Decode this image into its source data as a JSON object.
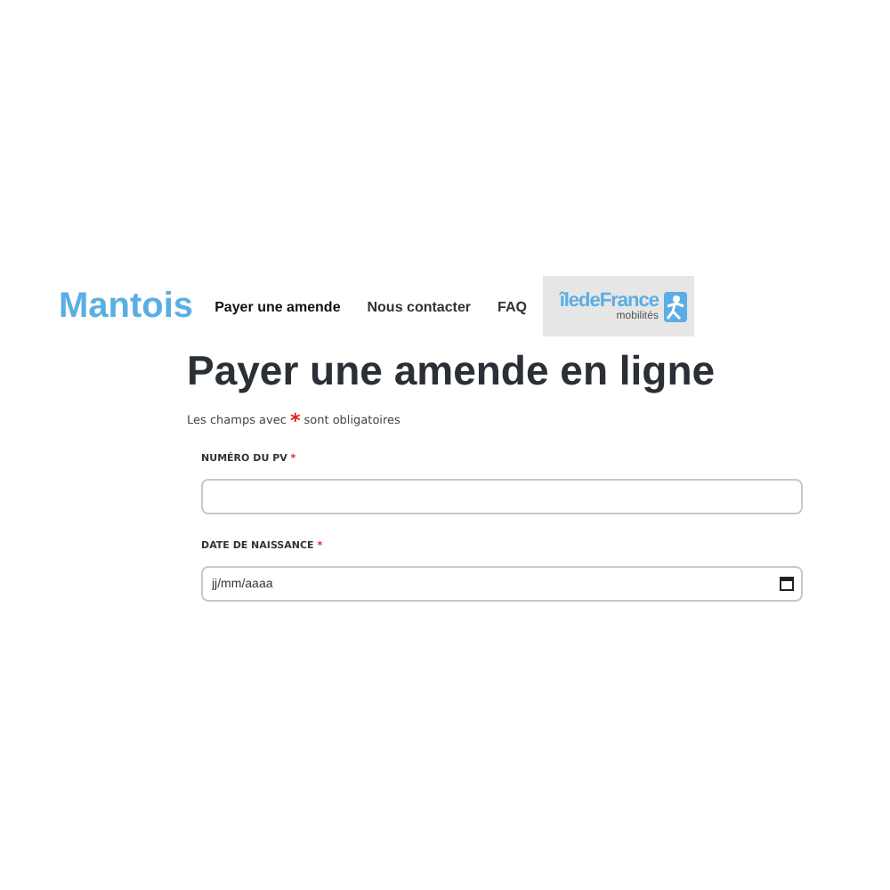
{
  "header": {
    "brand": "Mantois",
    "nav": [
      {
        "label": "Payer une amende",
        "selected": true
      },
      {
        "label": "Nous contacter",
        "selected": false
      },
      {
        "label": "FAQ",
        "selected": false
      }
    ],
    "logo": {
      "line1": "îledeFrance",
      "line2": "mobilités"
    }
  },
  "title": "Payer une amende en ligne",
  "note": {
    "before": "Les champs avec",
    "mark": "*",
    "after": "sont obligatoires"
  },
  "fields": [
    {
      "label": "NUMÉRO DU PV",
      "required": "*",
      "kind": "text"
    },
    {
      "label": "DATE DE NAISSANCE",
      "required": "*",
      "kind": "date",
      "placeholder": "jj/mm/aaaa"
    }
  ]
}
